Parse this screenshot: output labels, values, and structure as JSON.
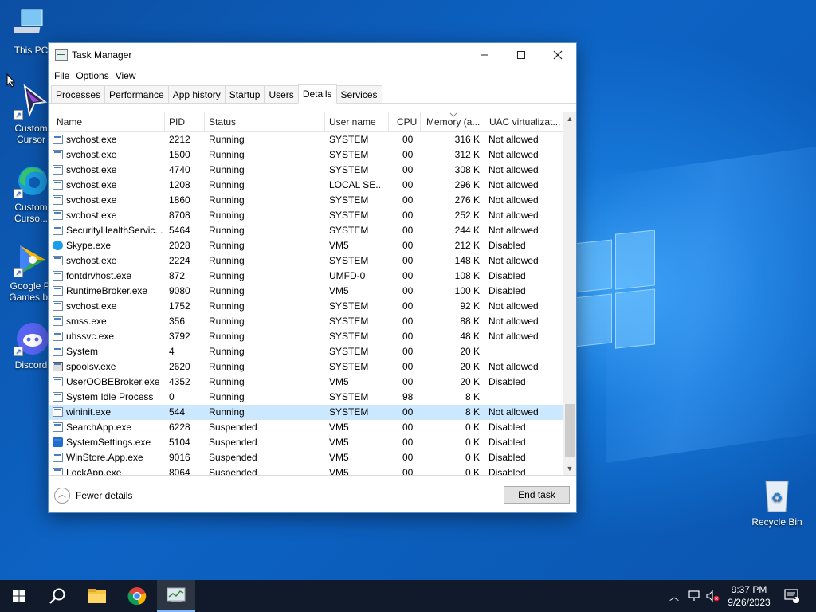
{
  "desktop": {
    "icons": [
      {
        "label": "This PC",
        "icon": "computer-icon"
      },
      {
        "label": "Custom\nCursor",
        "icon": "custom-cursor-icon"
      },
      {
        "label": "Custom\nCurso...",
        "icon": "edge-icon"
      },
      {
        "label": "Google Pl\nGames be",
        "icon": "google-play-games-icon"
      },
      {
        "label": "Discord",
        "icon": "discord-icon"
      },
      {
        "label": "Recycle Bin",
        "icon": "recycle-bin-icon"
      }
    ]
  },
  "window": {
    "title": "Task Manager",
    "menu": [
      "File",
      "Options",
      "View"
    ],
    "tabs": [
      "Processes",
      "Performance",
      "App history",
      "Startup",
      "Users",
      "Details",
      "Services"
    ],
    "active_tab": "Details",
    "columns": [
      "Name",
      "PID",
      "Status",
      "User name",
      "CPU",
      "Memory (a...",
      "UAC virtualizat..."
    ],
    "rows": [
      {
        "name": "svchost.exe",
        "pid": "2212",
        "status": "Running",
        "user": "SYSTEM",
        "cpu": "00",
        "mem": "316 K",
        "uac": "Not allowed",
        "icon": "process-icon"
      },
      {
        "name": "svchost.exe",
        "pid": "1500",
        "status": "Running",
        "user": "SYSTEM",
        "cpu": "00",
        "mem": "312 K",
        "uac": "Not allowed",
        "icon": "process-icon"
      },
      {
        "name": "svchost.exe",
        "pid": "4740",
        "status": "Running",
        "user": "SYSTEM",
        "cpu": "00",
        "mem": "308 K",
        "uac": "Not allowed",
        "icon": "process-icon"
      },
      {
        "name": "svchost.exe",
        "pid": "1208",
        "status": "Running",
        "user": "LOCAL SE...",
        "cpu": "00",
        "mem": "296 K",
        "uac": "Not allowed",
        "icon": "process-icon"
      },
      {
        "name": "svchost.exe",
        "pid": "1860",
        "status": "Running",
        "user": "SYSTEM",
        "cpu": "00",
        "mem": "276 K",
        "uac": "Not allowed",
        "icon": "process-icon"
      },
      {
        "name": "svchost.exe",
        "pid": "8708",
        "status": "Running",
        "user": "SYSTEM",
        "cpu": "00",
        "mem": "252 K",
        "uac": "Not allowed",
        "icon": "process-icon"
      },
      {
        "name": "SecurityHealthServic...",
        "pid": "5464",
        "status": "Running",
        "user": "SYSTEM",
        "cpu": "00",
        "mem": "244 K",
        "uac": "Not allowed",
        "icon": "process-icon"
      },
      {
        "name": "Skype.exe",
        "pid": "2028",
        "status": "Running",
        "user": "VM5",
        "cpu": "00",
        "mem": "212 K",
        "uac": "Disabled",
        "icon": "skype-icon"
      },
      {
        "name": "svchost.exe",
        "pid": "2224",
        "status": "Running",
        "user": "SYSTEM",
        "cpu": "00",
        "mem": "148 K",
        "uac": "Not allowed",
        "icon": "process-icon"
      },
      {
        "name": "fontdrvhost.exe",
        "pid": "872",
        "status": "Running",
        "user": "UMFD-0",
        "cpu": "00",
        "mem": "108 K",
        "uac": "Disabled",
        "icon": "process-icon"
      },
      {
        "name": "RuntimeBroker.exe",
        "pid": "9080",
        "status": "Running",
        "user": "VM5",
        "cpu": "00",
        "mem": "100 K",
        "uac": "Disabled",
        "icon": "process-icon"
      },
      {
        "name": "svchost.exe",
        "pid": "1752",
        "status": "Running",
        "user": "SYSTEM",
        "cpu": "00",
        "mem": "92 K",
        "uac": "Not allowed",
        "icon": "process-icon"
      },
      {
        "name": "smss.exe",
        "pid": "356",
        "status": "Running",
        "user": "SYSTEM",
        "cpu": "00",
        "mem": "88 K",
        "uac": "Not allowed",
        "icon": "process-icon"
      },
      {
        "name": "uhssvc.exe",
        "pid": "3792",
        "status": "Running",
        "user": "SYSTEM",
        "cpu": "00",
        "mem": "48 K",
        "uac": "Not allowed",
        "icon": "process-icon"
      },
      {
        "name": "System",
        "pid": "4",
        "status": "Running",
        "user": "SYSTEM",
        "cpu": "00",
        "mem": "20 K",
        "uac": "",
        "icon": "process-icon"
      },
      {
        "name": "spoolsv.exe",
        "pid": "2620",
        "status": "Running",
        "user": "SYSTEM",
        "cpu": "00",
        "mem": "20 K",
        "uac": "Not allowed",
        "icon": "printer-icon"
      },
      {
        "name": "UserOOBEBroker.exe",
        "pid": "4352",
        "status": "Running",
        "user": "VM5",
        "cpu": "00",
        "mem": "20 K",
        "uac": "Disabled",
        "icon": "process-icon"
      },
      {
        "name": "System Idle Process",
        "pid": "0",
        "status": "Running",
        "user": "SYSTEM",
        "cpu": "98",
        "mem": "8 K",
        "uac": "",
        "icon": "process-icon"
      },
      {
        "name": "wininit.exe",
        "pid": "544",
        "status": "Running",
        "user": "SYSTEM",
        "cpu": "00",
        "mem": "8 K",
        "uac": "Not allowed",
        "icon": "process-icon",
        "selected": true
      },
      {
        "name": "SearchApp.exe",
        "pid": "6228",
        "status": "Suspended",
        "user": "VM5",
        "cpu": "00",
        "mem": "0 K",
        "uac": "Disabled",
        "icon": "process-icon"
      },
      {
        "name": "SystemSettings.exe",
        "pid": "5104",
        "status": "Suspended",
        "user": "VM5",
        "cpu": "00",
        "mem": "0 K",
        "uac": "Disabled",
        "icon": "gear-icon"
      },
      {
        "name": "WinStore.App.exe",
        "pid": "9016",
        "status": "Suspended",
        "user": "VM5",
        "cpu": "00",
        "mem": "0 K",
        "uac": "Disabled",
        "icon": "process-icon"
      },
      {
        "name": "LockApp.exe",
        "pid": "8064",
        "status": "Suspended",
        "user": "VM5",
        "cpu": "00",
        "mem": "0 K",
        "uac": "Disabled",
        "icon": "process-icon"
      }
    ],
    "footer": {
      "fewer_details": "Fewer details",
      "end_task": "End task"
    }
  },
  "taskbar": {
    "items": [
      {
        "name": "start-button",
        "icon": "windows-icon"
      },
      {
        "name": "search-button",
        "icon": "search-icon"
      },
      {
        "name": "file-explorer-button",
        "icon": "folder-icon"
      },
      {
        "name": "chrome-button",
        "icon": "chrome-icon"
      },
      {
        "name": "task-manager-button",
        "icon": "task-manager-icon"
      }
    ],
    "clock": {
      "time": "9:37 PM",
      "date": "9/26/2023"
    },
    "notification_count": "1"
  },
  "colors": {
    "selection": "#cce8ff",
    "taskbar": "#101a2a",
    "accent": "#0a5fb8"
  }
}
